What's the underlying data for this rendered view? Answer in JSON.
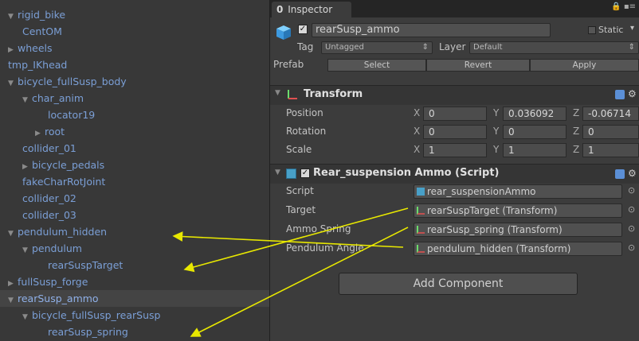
{
  "hierarchy": {
    "items": [
      {
        "label": "rigid_bike",
        "depth": 0,
        "arrow": "▼"
      },
      {
        "label": "CentOM",
        "depth": 1,
        "arrow": ""
      },
      {
        "label": "wheels",
        "depth": 0,
        "arrow": "▶"
      },
      {
        "label": "tmp_IKhead",
        "depth": 0,
        "arrow": ""
      },
      {
        "label": "bicycle_fullSusp_body",
        "depth": 0,
        "arrow": "▼"
      },
      {
        "label": "char_anim",
        "depth": 1,
        "arrow": "▼"
      },
      {
        "label": "locator19",
        "depth": 3,
        "arrow": ""
      },
      {
        "label": "root",
        "depth": 2,
        "arrow": "▶"
      },
      {
        "label": "collider_01",
        "depth": 1,
        "arrow": ""
      },
      {
        "label": "bicycle_pedals",
        "depth": 1,
        "arrow": "▶"
      },
      {
        "label": "fakeCharRotJoint",
        "depth": 1,
        "arrow": ""
      },
      {
        "label": "collider_02",
        "depth": 1,
        "arrow": ""
      },
      {
        "label": "collider_03",
        "depth": 1,
        "arrow": ""
      },
      {
        "label": "pendulum_hidden",
        "depth": 0,
        "arrow": "▼"
      },
      {
        "label": "pendulum",
        "depth": 1,
        "arrow": "▼"
      },
      {
        "label": "rearSuspTarget",
        "depth": 3,
        "arrow": ""
      },
      {
        "label": "fullSusp_forge",
        "depth": 0,
        "arrow": "▶"
      },
      {
        "label": "rearSusp_ammo",
        "depth": 0,
        "arrow": "▼",
        "selected": true
      },
      {
        "label": "bicycle_fullSusp_rearSusp",
        "depth": 1,
        "arrow": "▼"
      },
      {
        "label": "rearSusp_spring",
        "depth": 3,
        "arrow": ""
      }
    ]
  },
  "inspector": {
    "tab_label": "Inspector",
    "tab_glyph": "0",
    "object_name": "rearSusp_ammo",
    "static_label": "Static",
    "tag_label": "Tag",
    "tag_value": "Untagged",
    "layer_label": "Layer",
    "layer_value": "Default",
    "prefab_label": "Prefab",
    "select_label": "Select",
    "revert_label": "Revert",
    "apply_label": "Apply",
    "transform": {
      "title": "Transform",
      "rows": [
        {
          "label": "Position",
          "x": "0",
          "y": "0.036092",
          "z": "-0.06714"
        },
        {
          "label": "Rotation",
          "x": "0",
          "y": "0",
          "z": "0"
        },
        {
          "label": "Scale",
          "x": "1",
          "y": "1",
          "z": "1"
        }
      ],
      "axis_x": "X",
      "axis_y": "Y",
      "axis_z": "Z"
    },
    "script_component": {
      "title": "Rear_suspension Ammo (Script)",
      "rows": [
        {
          "label": "Script",
          "value": "rear_suspensionAmmo"
        },
        {
          "label": "Target",
          "value": "rearSuspTarget (Transform)"
        },
        {
          "label": "Ammo Spring",
          "value": "rearSusp_spring (Transform)"
        },
        {
          "label": "Pendulum Angle",
          "value": "pendulum_hidden (Transform)"
        }
      ]
    },
    "add_component_label": "Add Component"
  },
  "colors": {
    "arrow": "#e8e800",
    "hier_text": "#7b9fd6"
  }
}
